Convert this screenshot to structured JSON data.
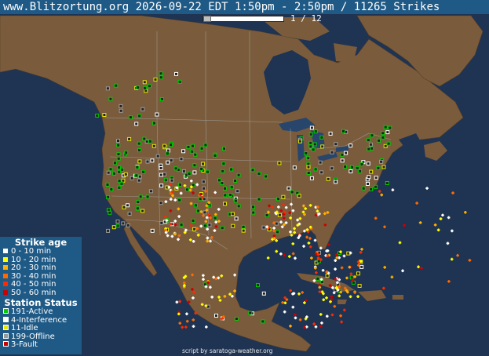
{
  "header": {
    "title": "www.Blitzortung.org 2026-09-22 EDT 1:50pm - 2:50pm / 11265 Strikes",
    "page_indicator": "1 / 12"
  },
  "slider": {
    "current": 1,
    "total": 12
  },
  "legend": {
    "strike_heading": "Strike age",
    "strike_ages": [
      {
        "label": "0 - 10 min",
        "color": "#ffffff"
      },
      {
        "label": "10 - 20 min",
        "color": "#ffff00"
      },
      {
        "label": "20 - 30 min",
        "color": "#ffb000"
      },
      {
        "label": "30 - 40 min",
        "color": "#ff6a00"
      },
      {
        "label": "40 - 50 min",
        "color": "#ff2a00"
      },
      {
        "label": "50 - 60 min",
        "color": "#cc0000"
      }
    ],
    "station_heading": "Station Status",
    "stations": [
      {
        "label": "191-Active",
        "color": "#00cc00"
      },
      {
        "label": "4-Interference",
        "color": "#ffffff"
      },
      {
        "label": "11-Idle",
        "color": "#e8e800"
      },
      {
        "label": "199-Offline",
        "color": "#9a9a9a"
      },
      {
        "label": "3-Fault",
        "color": "#cc0000"
      }
    ]
  },
  "footer": {
    "credit": "script by saratoga-weather.org"
  },
  "colors": {
    "ocean": "#1f3352",
    "land": "#7a5c3c",
    "panel": "#1f5a86"
  }
}
